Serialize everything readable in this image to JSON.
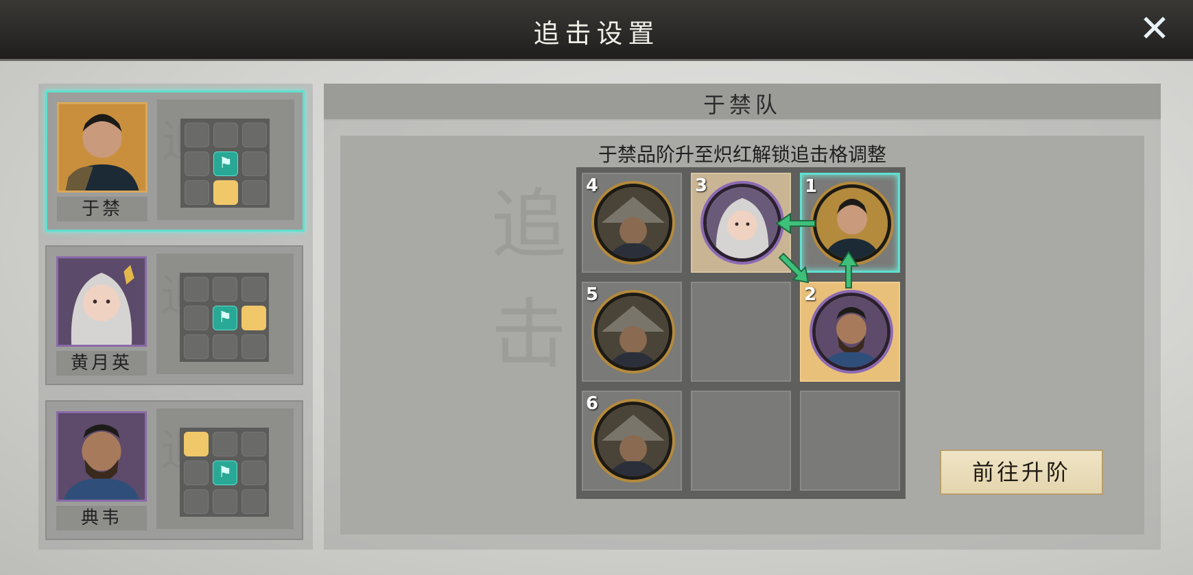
{
  "header": {
    "title": "追击设置",
    "close_icon": "close-icon"
  },
  "heroes": [
    {
      "name": "于禁",
      "frame": "gold",
      "selected": true
    },
    {
      "name": "黄月英",
      "frame": "purple",
      "selected": false
    },
    {
      "name": "典韦",
      "frame": "purple",
      "selected": false
    }
  ],
  "watermark": "追击",
  "team": {
    "name": "于禁队",
    "unlock_hint": "于禁品阶升至炽红解锁追击格调整",
    "slots": [
      {
        "number": "1",
        "hero": "于禁"
      },
      {
        "number": "2",
        "hero": "典韦"
      },
      {
        "number": "3",
        "hero": "黄月英"
      },
      {
        "number": "4",
        "hero": "soldier"
      },
      {
        "number": "5",
        "hero": "soldier"
      },
      {
        "number": "6",
        "hero": "soldier"
      }
    ]
  },
  "buttons": {
    "goto_upgrade": "前往升阶"
  },
  "colors": {
    "accent_teal": "#5fe0cf",
    "gold_slot": "#f0c86a"
  }
}
